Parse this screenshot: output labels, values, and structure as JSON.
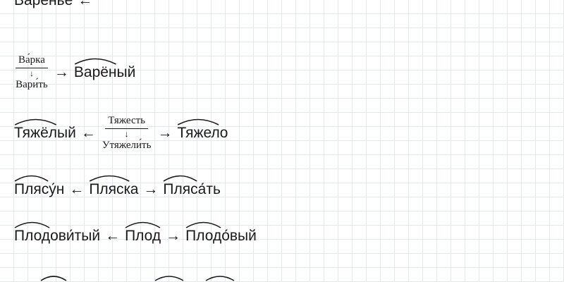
{
  "lines": [
    {
      "parts": [
        "Варенье",
        "←"
      ]
    },
    {
      "fraction": {
        "top": "Ва́рка",
        "arrow": "↓",
        "bottom": "Вари́ть"
      },
      "arrow": "→",
      "word": {
        "pre": "",
        "root": "Варён",
        "post": "ый"
      }
    },
    {
      "left_word": {
        "pre": "",
        "root": "Тяжёл",
        "post": "ый"
      },
      "arrow_left": "←",
      "fraction": {
        "top": "Тяжесть",
        "arrow": "↓",
        "bottom": "Утяжели́ть"
      },
      "arrow_right": "→",
      "right_word": {
        "pre": "",
        "root": "Тяжел",
        "post": "о"
      }
    },
    {
      "w1": {
        "root": "Пляс",
        "suffix": "у́н",
        "post": ""
      },
      "arrow_left": "←",
      "w2": {
        "root": "Пляск",
        "post": "а"
      },
      "arrow_right": "→",
      "w3": {
        "root": "Пляс",
        "suffix": "а́",
        "post": "ть"
      }
    },
    {
      "w1": {
        "root": "Плод",
        "suffix": "ови́т",
        "post": "ый"
      },
      "arrow_left": "←",
      "w2": {
        "root": "Плод",
        "post": ""
      },
      "arrow_right": "→",
      "w3": {
        "root": "Плод",
        "suffix": "о́в",
        "post": "ый"
      }
    }
  ],
  "arc_color": "#1a1a1a",
  "grid_color": "#e3e8f0"
}
